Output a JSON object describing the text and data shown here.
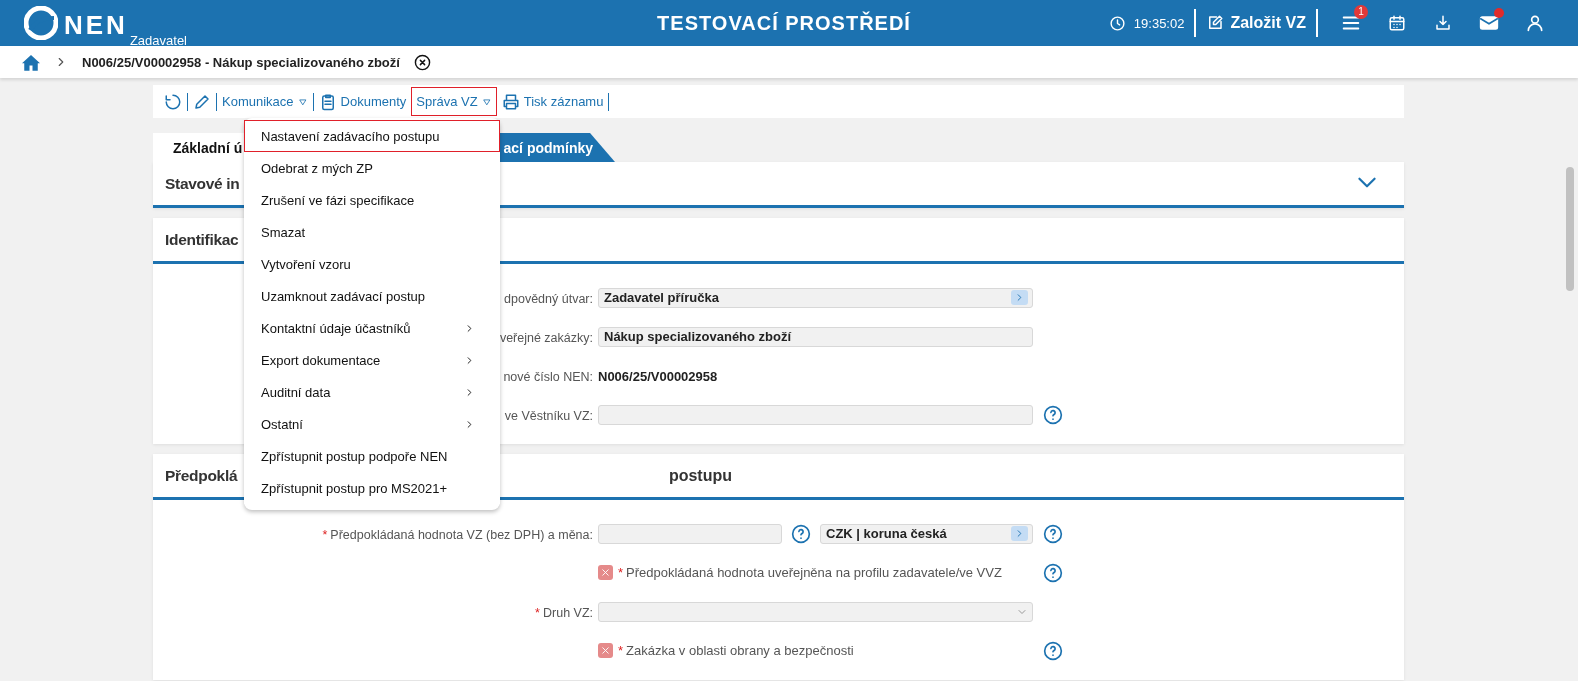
{
  "header": {
    "logo": "NEN",
    "logo_sub": "Zadavatel",
    "title": "TESTOVACÍ PROSTŘEDÍ",
    "time": "19:35:02",
    "create_button": "Založit VZ",
    "icons": [
      {
        "kind": "menu",
        "badge": "1"
      },
      {
        "kind": "calendar"
      },
      {
        "kind": "download"
      },
      {
        "kind": "mail",
        "dot": true
      },
      {
        "kind": "user"
      }
    ]
  },
  "breadcrumb": {
    "current": "N006/25/V00002958 - Nákup specializovaného zboží"
  },
  "toolbar": [
    {
      "kind": "refresh",
      "highlighted": false
    },
    {
      "kind": "edit",
      "highlighted": false
    },
    {
      "kind": "dropdown",
      "label": "Komunikace",
      "highlighted": false
    },
    {
      "kind": "clipboard",
      "label": "Dokumenty",
      "highlighted": false
    },
    {
      "kind": "dropdown",
      "label": "Správa VZ",
      "highlighted": true
    },
    {
      "kind": "printer",
      "label": "Tisk záznamu",
      "highlighted": false
    }
  ],
  "menu": {
    "items": [
      {
        "label": "Nastavení zadávacího postupu",
        "highlighted": true
      },
      {
        "label": "Odebrat z mých ZP",
        "highlighted": false
      },
      {
        "label": "Zrušení ve fázi specifikace",
        "highlighted": false
      },
      {
        "label": "Smazat",
        "highlighted": false
      },
      {
        "label": "Vytvoření vzoru",
        "highlighted": false
      },
      {
        "label": "Uzamknout zadávací postup",
        "highlighted": false
      },
      {
        "label": "Kontaktní údaje účastníků",
        "submenu": true,
        "highlighted": false
      },
      {
        "label": "Export dokumentace",
        "submenu": true,
        "highlighted": false
      },
      {
        "label": "Auditní data",
        "submenu": true,
        "highlighted": false
      },
      {
        "label": "Ostatní",
        "submenu": true,
        "highlighted": false
      },
      {
        "label": "Zpřístupnit postup podpoře NEN",
        "highlighted": false
      },
      {
        "label": "Zpřístupnit postup pro MS2021+",
        "highlighted": false
      }
    ]
  },
  "tabs": [
    {
      "label": "Základní ú",
      "selected": true
    },
    {
      "label": "ací podmínky",
      "selected": false
    }
  ],
  "sections": [
    {
      "kind": "collapsible",
      "title": "Stavové in",
      "expanded": false
    },
    {
      "kind": "form",
      "title": "Identifikac",
      "rows": [
        {
          "kind": "select",
          "label": "dpovědný útvar:",
          "value": "Zadavatel příručka"
        },
        {
          "kind": "text",
          "label": "veřejné zakázky:",
          "value": "Nákup specializovaného zboží"
        },
        {
          "kind": "static",
          "label": "nové číslo NEN:",
          "value": "N006/25/V00002958"
        },
        {
          "kind": "text",
          "label": "ve Věstníku VZ:",
          "help": true
        }
      ]
    },
    {
      "kind": "form",
      "title": "Předpoklá",
      "title_rest": "postupu",
      "rows": [
        {
          "kind": "money",
          "mark": "*",
          "label": "Předpokládaná hodnota VZ (bez DPH) a měna:",
          "currency": "CZK | koruna česká",
          "help": true
        },
        {
          "kind": "checkbox",
          "mark": "*",
          "label": "Předpokládaná hodnota uveřejněna na profilu zadavatele/ve VVZ",
          "checked": false,
          "help": true
        },
        {
          "kind": "dropdown",
          "mark": "*",
          "label": "Druh VZ:"
        },
        {
          "kind": "checkbox",
          "mark": "*",
          "label": "Zakázka v oblasti obrany a bezpečnosti",
          "checked": false,
          "help": true
        }
      ]
    }
  ]
}
